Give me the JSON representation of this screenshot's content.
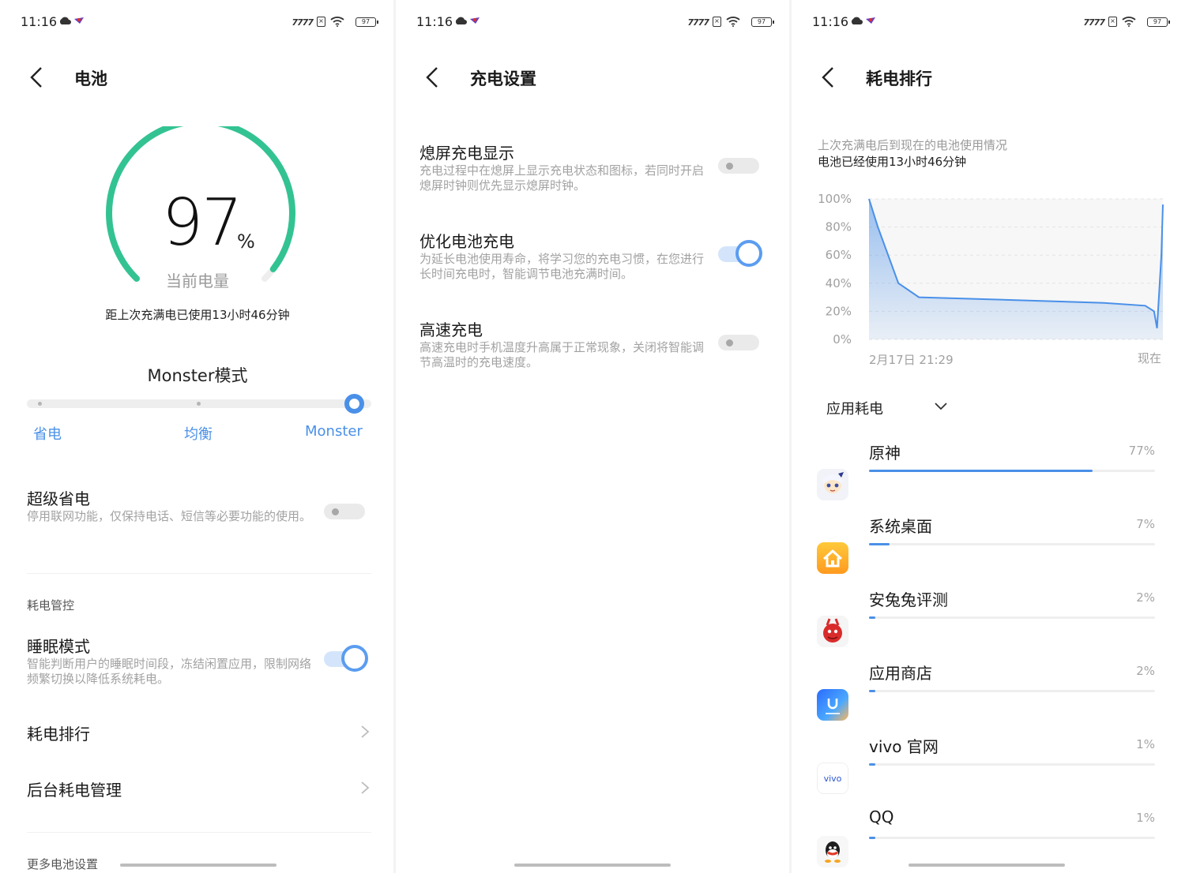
{
  "status": {
    "time": "11:16",
    "signal": "7777",
    "battery": "97"
  },
  "battery_screen": {
    "title": "电池",
    "level": 97,
    "level_text": "97",
    "percent_sign": "%",
    "gauge_label": "当前电量",
    "since_full": "距上次充满电已使用13小时46分钟",
    "mode": {
      "title": "Monster模式",
      "options": [
        "省电",
        "均衡",
        "Monster"
      ],
      "selected": "Monster"
    },
    "super_save": {
      "title": "超级省电",
      "desc": "停用联网功能，仅保持电话、短信等必要功能的使用。",
      "enabled": false
    },
    "control_label": "耗电管控",
    "sleep_mode": {
      "title": "睡眠模式",
      "desc": "智能判断用户的睡眠时间段，冻结闲置应用，限制网络频繁切换以降低系统耗电。",
      "enabled": true
    },
    "ranking_link": "耗电排行",
    "background_link": "后台耗电管理",
    "more_label": "更多电池设置"
  },
  "charge_screen": {
    "title": "充电设置",
    "items": [
      {
        "title": "熄屏充电显示",
        "desc": "充电过程中在熄屏上显示充电状态和图标，若同时开启熄屏时钟则优先显示熄屏时钟。",
        "enabled": false
      },
      {
        "title": "优化电池充电",
        "desc": "为延长电池使用寿命，将学习您的充电习惯，在您进行长时间充电时，智能调节电池充满时间。",
        "enabled": true
      },
      {
        "title": "高速充电",
        "desc": "高速充电时手机温度升高属于正常现象，关闭将智能调节高温时的充电速度。",
        "enabled": false
      }
    ]
  },
  "ranking_screen": {
    "title": "耗电排行",
    "usage_caption": "上次充满电后到现在的电池使用情况",
    "usage_value": "电池已经使用13小时46分钟",
    "app_selector": "应用耗电",
    "apps": [
      {
        "name": "原神",
        "percent": "77%",
        "value": 0.77,
        "icon": "genshin-icon"
      },
      {
        "name": "系统桌面",
        "percent": "7%",
        "value": 0.07,
        "icon": "home-launcher-icon"
      },
      {
        "name": "安兔兔评测",
        "percent": "2%",
        "value": 0.02,
        "icon": "antutu-icon"
      },
      {
        "name": "应用商店",
        "percent": "2%",
        "value": 0.02,
        "icon": "app-store-icon"
      },
      {
        "name": "vivo 官网",
        "percent": "1%",
        "value": 0.01,
        "icon": "vivo-icon"
      },
      {
        "name": "QQ",
        "percent": "1%",
        "value": 0.01,
        "icon": "qq-icon"
      }
    ]
  },
  "chart_data": {
    "type": "area",
    "ylim": [
      0,
      100
    ],
    "y_ticks": [
      "100%",
      "80%",
      "60%",
      "40%",
      "20%",
      "0%"
    ],
    "x_labels": [
      "2月17日 21:29",
      "现在"
    ],
    "grid": true,
    "color": "#4a90e8",
    "series": [
      {
        "x": [
          0,
          0.03,
          0.1,
          0.17,
          0.5,
          0.8,
          0.94,
          0.97,
          0.98,
          0.995,
          1.0
        ],
        "values": [
          100,
          80,
          40,
          30,
          28,
          26,
          24,
          20,
          8,
          60,
          96
        ]
      }
    ]
  }
}
